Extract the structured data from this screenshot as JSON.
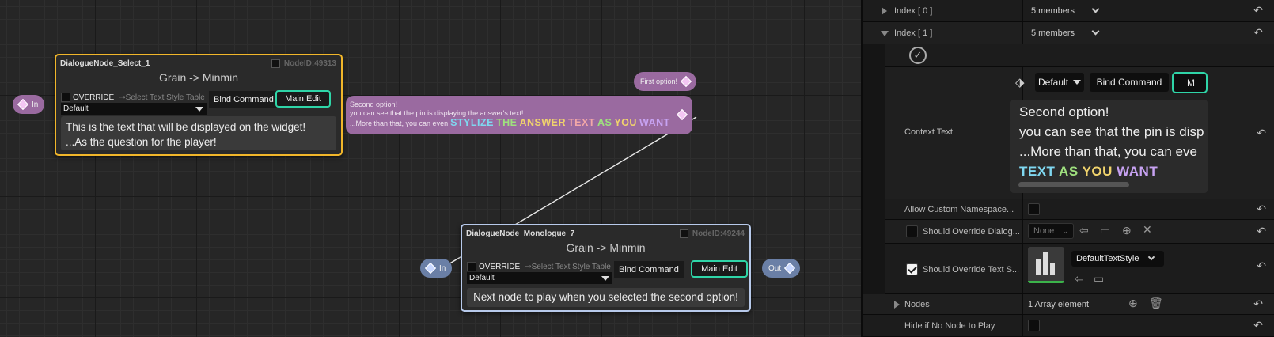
{
  "graph": {
    "select_node": {
      "title": "DialogueNode_Select_1",
      "node_id": "NodeID:49313",
      "speaker": "Grain -> Minmin",
      "override_label": "OVERRIDE",
      "style_table_label": "Select Text Style Table",
      "style_combo": "Default",
      "bind_command": "Bind Command",
      "main_edit": "Main Edit",
      "text_line1": "This is the text that will be displayed on the widget!",
      "text_line2": "...As the question for the player!",
      "in_pin": "In",
      "border_color": "#f1b62a"
    },
    "answer_pins": {
      "first": "First option!",
      "second_line1": "Second option!",
      "second_line2": "you can see that the pin is displaying the answer's text!",
      "second_line3_prefix": "...More than that, you can even",
      "stylize_words": [
        "STYLIZE",
        "THE",
        "ANSWER",
        "TEXT",
        "AS",
        "YOU",
        "WANT"
      ]
    },
    "monologue_node": {
      "title": "DialogueNode_Monologue_7",
      "node_id": "NodeID:49244",
      "speaker": "Grain -> Minmin",
      "override_label": "OVERRIDE",
      "style_table_label": "Select Text Style Table",
      "style_combo": "Default",
      "bind_command": "Bind Command",
      "main_edit": "Main Edit",
      "text": "Next node to play when you selected the second option!",
      "in_pin": "In",
      "out_pin": "Out",
      "border_color": "#b7c9ea"
    }
  },
  "details": {
    "index0_label": "Index [ 0 ]",
    "index0_value": "5 members",
    "index1_label": "Index [ 1 ]",
    "index1_value": "5 members",
    "context_text_label": "Context Text",
    "context_style": "Default",
    "context_bind_command": "Bind Command",
    "context_main_edit_partial": "M",
    "context_line1": "Second option!",
    "context_line2": "you can see that the pin is disp",
    "context_line3": "...More than that, you can eve",
    "context_line4_words": [
      "TEXT",
      "AS",
      "YOU",
      "WANT"
    ],
    "allow_ns_label": "Allow Custom Namespace...",
    "should_override_dialog_label": "Should Override Dialog...",
    "should_override_dialog_value": "None",
    "should_override_text_label": "Should Override Text S...",
    "text_style_value": "DefaultTextStyle",
    "nodes_label": "Nodes",
    "nodes_value": "1 Array element",
    "hide_label": "Hide if No Node to Play"
  }
}
